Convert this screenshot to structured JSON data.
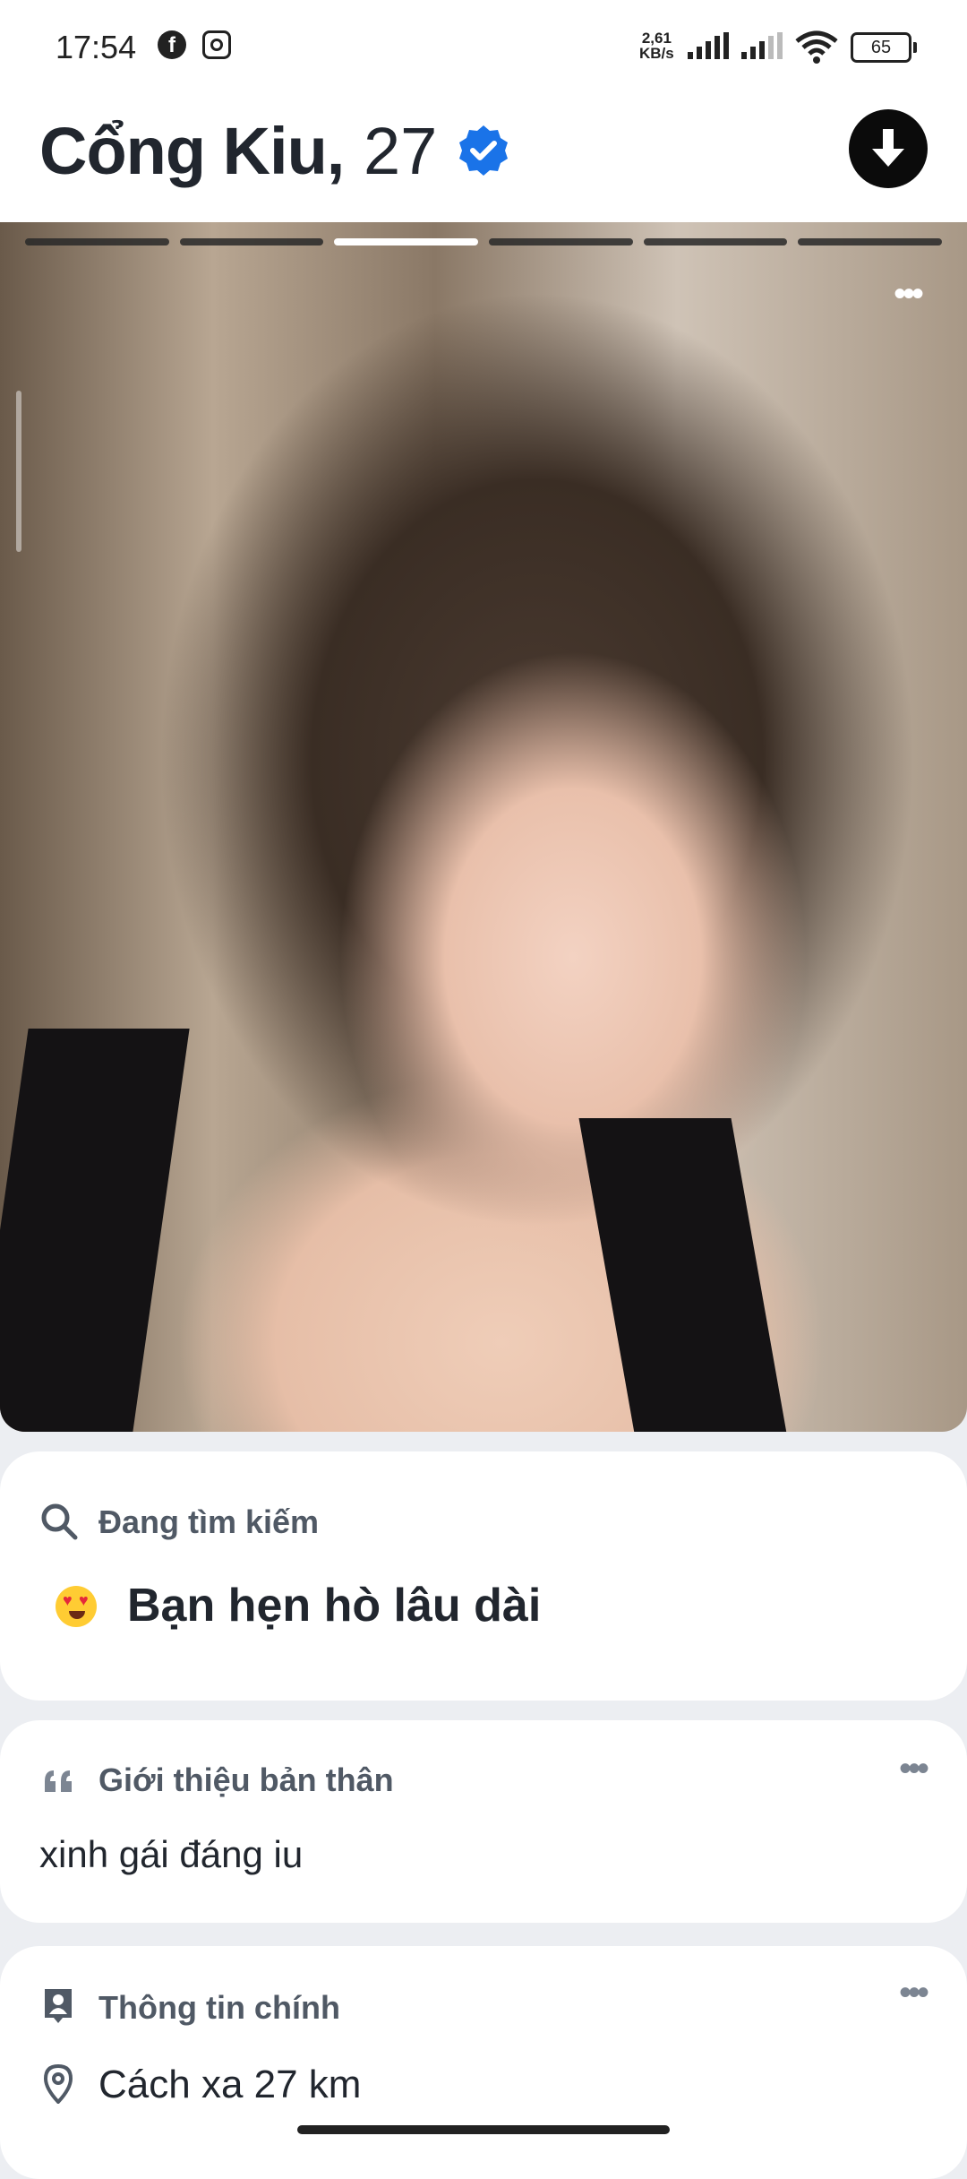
{
  "status_bar": {
    "time": "17:54",
    "speed_value": "2,61",
    "speed_unit": "KB/s",
    "battery": "65",
    "icons": [
      "facebook-icon",
      "instagram-icon",
      "signal-icon",
      "wifi-icon",
      "battery-icon"
    ]
  },
  "profile": {
    "name": "Cổng Kiu,",
    "age": "27",
    "verified": true,
    "photo_count": 6,
    "active_photo": 3
  },
  "looking_for": {
    "title": "Đang tìm kiếm",
    "value": "Bạn hẹn hò lâu dài",
    "icon": "search-icon"
  },
  "bio": {
    "title": "Giới thiệu bản thân",
    "text": "xinh gái đáng iu",
    "icon": "quote-icon"
  },
  "main_info": {
    "title": "Thông tin chính",
    "distance": "Cách xa 27 km",
    "icons": [
      "id-card-icon",
      "location-pin-icon"
    ]
  },
  "colors": {
    "verified_blue": "#1a73e8",
    "text_dark": "#21262e",
    "label_gray": "#505965",
    "background": "#eceef2"
  }
}
